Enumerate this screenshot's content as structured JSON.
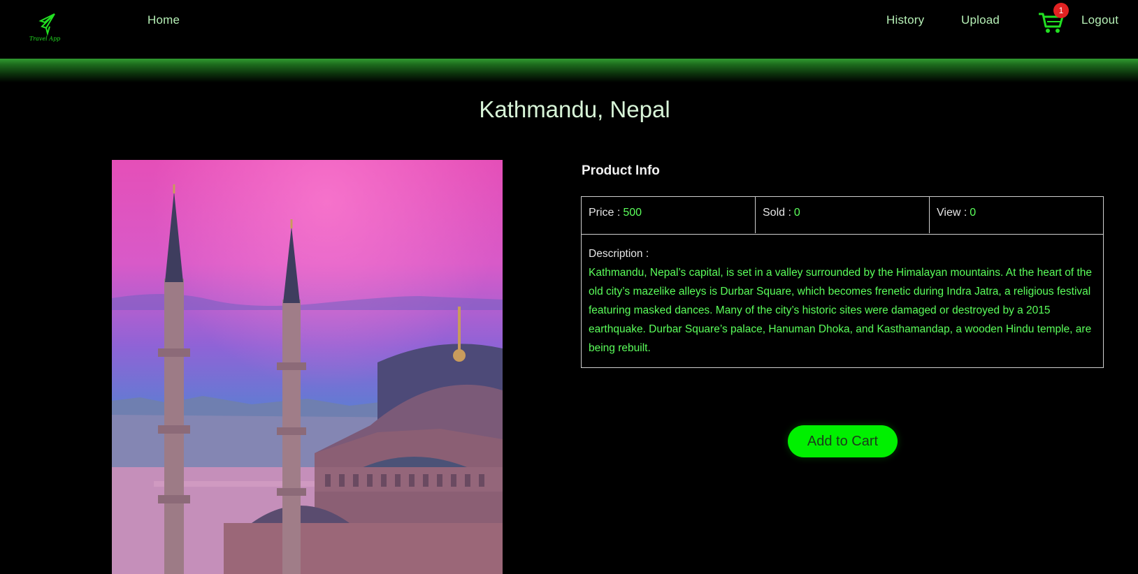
{
  "header": {
    "logo_text": "Travel App",
    "nav": {
      "home": "Home",
      "history": "History",
      "upload": "Upload",
      "logout": "Logout"
    },
    "cart_count": "1",
    "cart_icon": "shopping-cart-icon"
  },
  "product": {
    "title": "Kathmandu, Nepal",
    "info_heading": "Product Info",
    "price_label": "Price :",
    "price_value": "500",
    "sold_label": "Sold :",
    "sold_value": "0",
    "view_label": "View :",
    "view_value": "0",
    "description_label": "Description :",
    "description": "Kathmandu, Nepal’s capital, is set in a valley surrounded by the Himalayan mountains. At the heart of the old city’s mazelike alleys is Durbar Square, which becomes frenetic during Indra Jatra, a religious festival featuring masked dances. Many of the city’s historic sites were damaged or destroyed by a 2015 earthquake. Durbar Square’s palace, Hanuman Dhoka, and Kasthamandap, a wooden Hindu temple, are being rebuilt.",
    "add_to_cart_label": "Add to Cart"
  },
  "colors": {
    "background": "#000000",
    "accent_green": "#00f000",
    "text_green": "#5bff5b",
    "nav_text": "#b6f0b6",
    "badge_red": "#e22222",
    "glow_bar": "#2f9a2f"
  }
}
